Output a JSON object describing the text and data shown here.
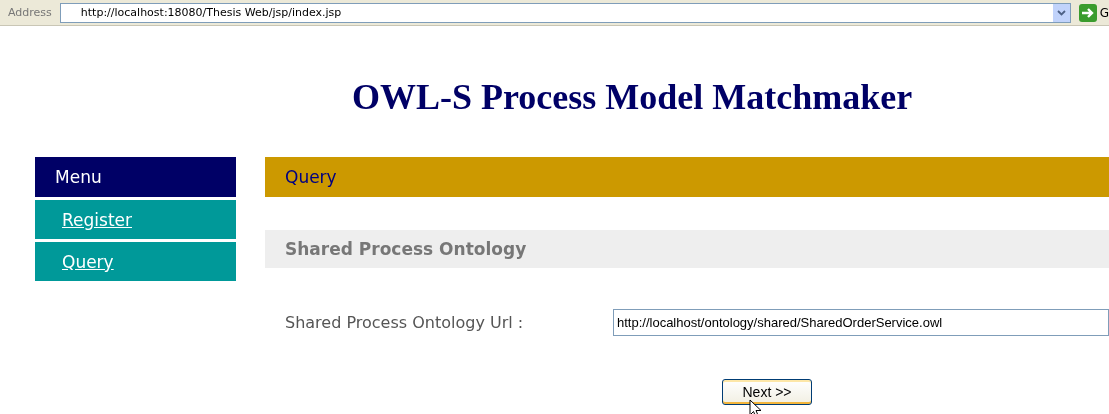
{
  "address_bar": {
    "label": "Address",
    "url": "http://localhost:18080/Thesis Web/jsp/index.jsp",
    "go_label": "G"
  },
  "page_title": "OWL-S Process Model Matchmaker",
  "menu": {
    "header": "Menu",
    "items": [
      {
        "label": "Register"
      },
      {
        "label": "Query"
      }
    ]
  },
  "section": {
    "title": "Query",
    "subtitle": "Shared Process Ontology",
    "field": {
      "label": "Shared Process Ontology Url :",
      "value": "http://localhost/ontology/shared/SharedOrderService.owl"
    },
    "button": "Next >>"
  }
}
